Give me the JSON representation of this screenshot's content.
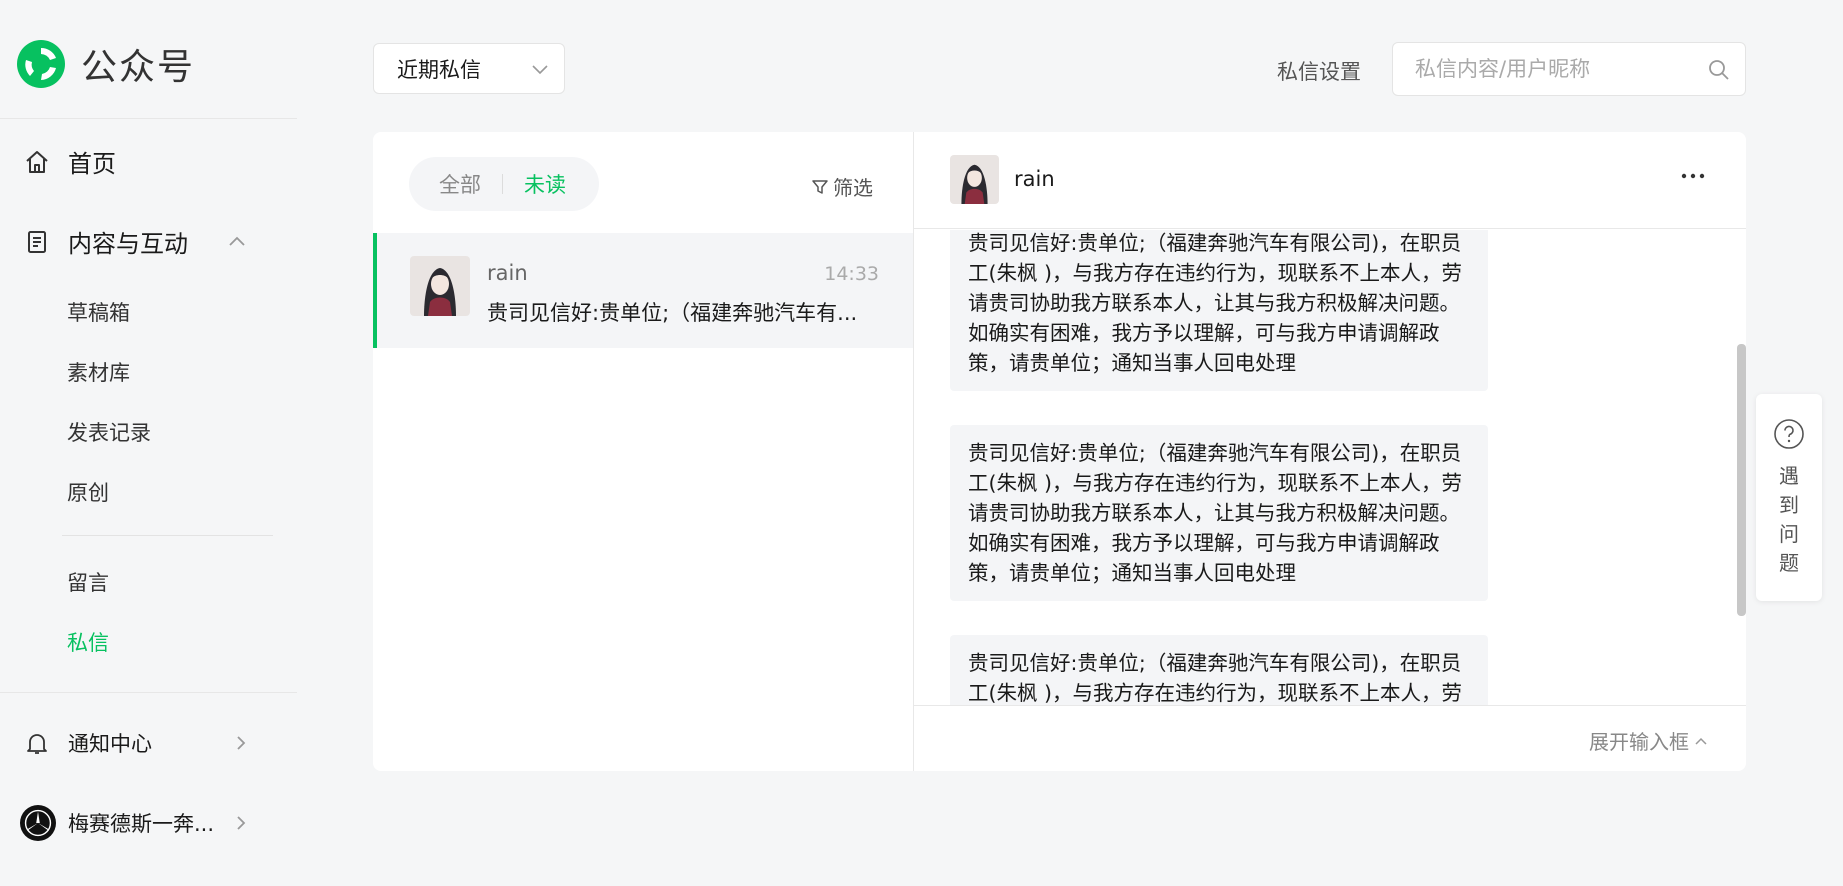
{
  "app": {
    "name": "公众号"
  },
  "sidebar": {
    "home": "首页",
    "content": "内容与互动",
    "sub_items": [
      "草稿箱",
      "素材库",
      "发表记录",
      "原创"
    ],
    "sub_items2": [
      "留言",
      "私信"
    ],
    "active_item": "私信",
    "notifications": "通知中心",
    "account": "梅赛德斯一奔..."
  },
  "toolbar": {
    "filter_dropdown": "近期私信",
    "settings_label": "私信设置",
    "search_placeholder": "私信内容/用户昵称"
  },
  "list": {
    "tabs": {
      "all": "全部",
      "unread": "未读",
      "active": "未读"
    },
    "filter_label": "筛选",
    "conversations": [
      {
        "name": "rain",
        "time": "14:33",
        "preview": "贵司见信好:贵单位;（福建奔驰汽车有..."
      }
    ]
  },
  "chat": {
    "name": "rain",
    "messages": [
      "贵司见信好:贵单位;（福建奔驰汽车有限公司)，在职员工(朱枫 )，与我方存在违约行为，现联系不上本人，劳请贵司协助我方联系本人，让其与我方积极解决问题。如确实有困难，我方予以理解，可与我方申请调解政策，请贵单位；通知当事人回电处理",
      "贵司见信好:贵单位;（福建奔驰汽车有限公司)，在职员工(朱枫 )，与我方存在违约行为，现联系不上本人，劳请贵司协助我方联系本人，让其与我方积极解决问题。如确实有困难，我方予以理解，可与我方申请调解政策，请贵单位；通知当事人回电处理",
      "贵司见信好:贵单位;（福建奔驰汽车有限公司)，在职员工(朱枫 )，与我方存在违约行为，现联系不上本人，劳请贵司协助我方联系本人，让其与我方积极解决问题。如确实有困难，我方予以理解，可与我方申请调解政策，请贵单位；通知当事人回电处理"
    ],
    "expand_label": "展开输入框"
  },
  "help": {
    "label": "遇到问题"
  },
  "colors": {
    "accent": "#07c160",
    "background": "#f5f6f7"
  }
}
